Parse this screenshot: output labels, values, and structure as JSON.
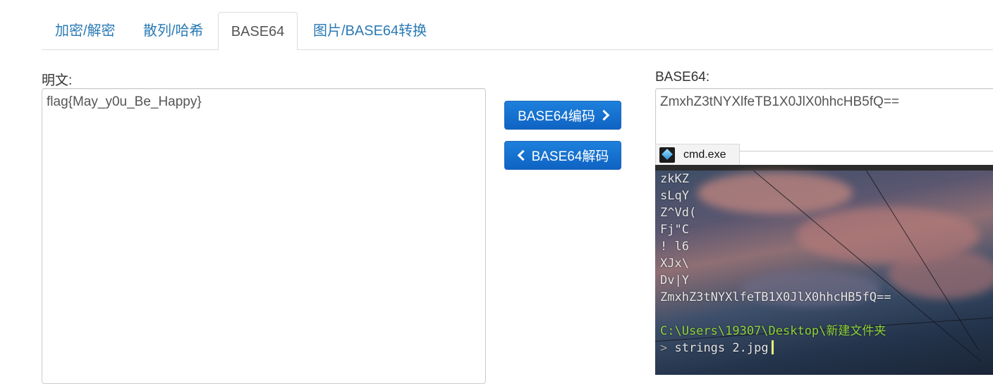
{
  "tabs": [
    {
      "label": "加密/解密",
      "active": false
    },
    {
      "label": "散列/哈希",
      "active": false
    },
    {
      "label": "BASE64",
      "active": true
    },
    {
      "label": "图片/BASE64转换",
      "active": false
    }
  ],
  "plain": {
    "label": "明文:",
    "value": "flag{May_y0u_Be_Happy}"
  },
  "base64": {
    "label": "BASE64:",
    "value": "ZmxhZ3tNYXlfeTB1X0JlX0hhcHB5fQ=="
  },
  "buttons": {
    "encode_label": "BASE64编码",
    "decode_label": "BASE64解码"
  },
  "cmd": {
    "tab_title": "cmd.exe",
    "output_lines": [
      "zkKZ",
      "sLqY",
      "Z^Vd(",
      "Fj\"C",
      "! l6",
      "XJx\\",
      "Dv|Y",
      "ZmxhZ3tNYXlfeTB1X0JlX0hhcHB5fQ=="
    ],
    "prompt_path": "C:\\Users\\19307\\Desktop\\新建文件夹",
    "prompt_symbol": ">",
    "command": "strings 2.jpg"
  },
  "colors": {
    "tab_link": "#2a7ab5",
    "button_bg": "#1a73d0",
    "prompt_path": "#8fd43a"
  }
}
